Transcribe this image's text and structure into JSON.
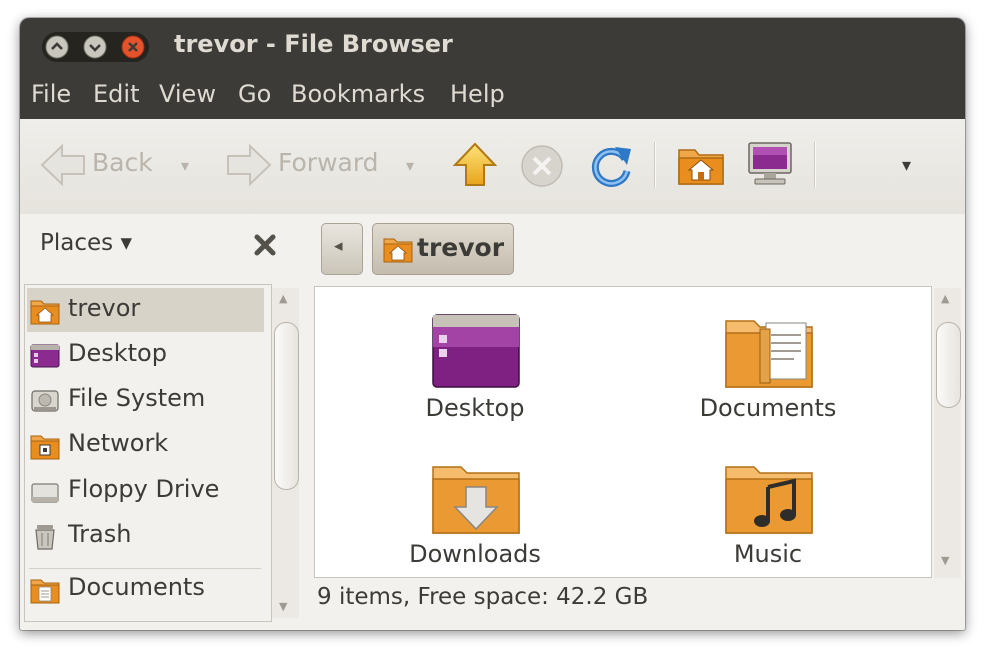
{
  "window": {
    "title": "trevor - File Browser"
  },
  "menubar": [
    "File",
    "Edit",
    "View",
    "Go",
    "Bookmarks",
    "Help"
  ],
  "toolbar": {
    "back_label": "Back",
    "forward_label": "Forward",
    "dropdown_glyph": "▾",
    "overflow_glyph": "▾"
  },
  "sidebar": {
    "header": "Places ▾",
    "items": [
      {
        "label": "trevor",
        "icon": "home-folder-icon",
        "selected": true
      },
      {
        "label": "Desktop",
        "icon": "desktop-icon"
      },
      {
        "label": "File System",
        "icon": "harddisk-icon"
      },
      {
        "label": "Network",
        "icon": "network-icon"
      },
      {
        "label": "Floppy Drive",
        "icon": "floppy-icon"
      },
      {
        "label": "Trash",
        "icon": "trash-icon"
      },
      {
        "label": "Documents",
        "icon": "documents-folder-icon"
      }
    ]
  },
  "location": {
    "back_glyph": "◂",
    "current": "trevor"
  },
  "files": [
    {
      "name": "Desktop",
      "icon": "desktop-folder-icon"
    },
    {
      "name": "Documents",
      "icon": "documents-folder-icon"
    },
    {
      "name": "Downloads",
      "icon": "downloads-folder-icon"
    },
    {
      "name": "Music",
      "icon": "music-folder-icon"
    }
  ],
  "status": "9 items, Free space: 42.2 GB",
  "colors": {
    "titlebar": "#3c3b37",
    "accent_orange": "#e0861c",
    "selection": "#d8d3c9"
  }
}
